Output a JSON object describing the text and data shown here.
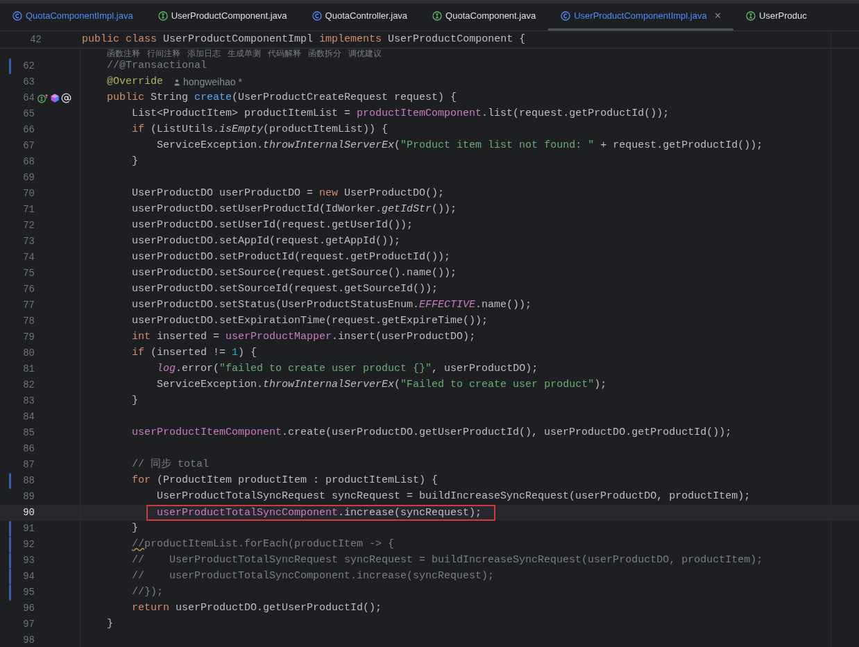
{
  "tabs": [
    {
      "label": "QuotaComponentImpl.java",
      "kind": "class",
      "color": "#548af7",
      "selected": false
    },
    {
      "label": "UserProductComponent.java",
      "kind": "interface",
      "color": "#dfe1e5",
      "selected": false
    },
    {
      "label": "QuotaController.java",
      "kind": "class",
      "color": "#dfe1e5",
      "selected": false
    },
    {
      "label": "QuotaComponent.java",
      "kind": "interface",
      "color": "#dfe1e5",
      "selected": false
    },
    {
      "label": "UserProductComponentImpl.java",
      "kind": "class",
      "color": "#548af7",
      "selected": true,
      "close": "×"
    },
    {
      "label": "UserProduc",
      "kind": "interface",
      "color": "#dfe1e5",
      "selected": false
    }
  ],
  "sticky_line": {
    "number": "42",
    "tokens": [
      {
        "kind": "kw",
        "text": "public class "
      },
      {
        "kind": "plain",
        "text": "UserProductComponentImpl "
      },
      {
        "kind": "kw",
        "text": "implements "
      },
      {
        "kind": "plain",
        "text": "UserProductComponent {"
      }
    ]
  },
  "code_lens": [
    "函数注释",
    "行间注释",
    "添加日志",
    "生成单测",
    "代码解释",
    "函数拆分",
    "调优建议"
  ],
  "lines": [
    {
      "number": "62",
      "modified": true,
      "tokens": [
        {
          "kind": "comment",
          "text": "    //@Transactional"
        }
      ]
    },
    {
      "number": "63",
      "tokens": [
        {
          "kind": "annotation",
          "text": "    @Override"
        }
      ],
      "author": "hongweihao *"
    },
    {
      "number": "64",
      "gutter_icons": true,
      "tokens": [
        {
          "kind": "kw",
          "text": "    public "
        },
        {
          "kind": "plain",
          "text": "String "
        },
        {
          "kind": "fn",
          "text": "create"
        },
        {
          "kind": "plain",
          "text": "(UserProductCreateRequest request) {"
        }
      ]
    },
    {
      "number": "65",
      "tokens": [
        {
          "kind": "plain",
          "text": "        List<ProductItem> productItemList = "
        },
        {
          "kind": "field",
          "text": "productItemComponent"
        },
        {
          "kind": "plain",
          "text": ".list(request.getProductId());"
        }
      ]
    },
    {
      "number": "66",
      "tokens": [
        {
          "kind": "kw",
          "text": "        if "
        },
        {
          "kind": "plain",
          "text": "(ListUtils."
        },
        {
          "kind": "static",
          "text": "isEmpty"
        },
        {
          "kind": "plain",
          "text": "(productItemList)) {"
        }
      ]
    },
    {
      "number": "67",
      "tokens": [
        {
          "kind": "plain",
          "text": "            ServiceException."
        },
        {
          "kind": "static",
          "text": "throwInternalServerEx"
        },
        {
          "kind": "plain",
          "text": "("
        },
        {
          "kind": "str",
          "text": "\"Product item list not found: \""
        },
        {
          "kind": "plain",
          "text": " + request.getProductId());"
        }
      ]
    },
    {
      "number": "68",
      "tokens": [
        {
          "kind": "plain",
          "text": "        }"
        }
      ]
    },
    {
      "number": "69"
    },
    {
      "number": "70",
      "tokens": [
        {
          "kind": "plain",
          "text": "        UserProductDO userProductDO = "
        },
        {
          "kind": "kw",
          "text": "new "
        },
        {
          "kind": "plain",
          "text": "UserProductDO();"
        }
      ]
    },
    {
      "number": "71",
      "tokens": [
        {
          "kind": "plain",
          "text": "        userProductDO.setUserProductId(IdWorker."
        },
        {
          "kind": "static",
          "text": "getIdStr"
        },
        {
          "kind": "plain",
          "text": "());"
        }
      ]
    },
    {
      "number": "72",
      "tokens": [
        {
          "kind": "plain",
          "text": "        userProductDO.setUserId(request.getUserId());"
        }
      ]
    },
    {
      "number": "73",
      "tokens": [
        {
          "kind": "plain",
          "text": "        userProductDO.setAppId(request.getAppId());"
        }
      ]
    },
    {
      "number": "74",
      "tokens": [
        {
          "kind": "plain",
          "text": "        userProductDO.setProductId(request.getProductId());"
        }
      ]
    },
    {
      "number": "75",
      "tokens": [
        {
          "kind": "plain",
          "text": "        userProductDO.setSource(request.getSource().name());"
        }
      ]
    },
    {
      "number": "76",
      "tokens": [
        {
          "kind": "plain",
          "text": "        userProductDO.setSourceId(request.getSourceId());"
        }
      ]
    },
    {
      "number": "77",
      "tokens": [
        {
          "kind": "plain",
          "text": "        userProductDO.setStatus(UserProductStatusEnum."
        },
        {
          "kind": "constant",
          "text": "EFFECTIVE"
        },
        {
          "kind": "plain",
          "text": ".name());"
        }
      ]
    },
    {
      "number": "78",
      "tokens": [
        {
          "kind": "plain",
          "text": "        userProductDO.setExpirationTime(request.getExpireTime());"
        }
      ]
    },
    {
      "number": "79",
      "tokens": [
        {
          "kind": "kw",
          "text": "        int "
        },
        {
          "kind": "plain",
          "text": "inserted = "
        },
        {
          "kind": "field",
          "text": "userProductMapper"
        },
        {
          "kind": "plain",
          "text": ".insert(userProductDO);"
        }
      ]
    },
    {
      "number": "80",
      "tokens": [
        {
          "kind": "kw",
          "text": "        if "
        },
        {
          "kind": "plain",
          "text": "(inserted != "
        },
        {
          "kind": "num",
          "text": "1"
        },
        {
          "kind": "plain",
          "text": ") {"
        }
      ]
    },
    {
      "number": "81",
      "tokens": [
        {
          "kind": "constant",
          "text": "            log"
        },
        {
          "kind": "plain",
          "text": ".error("
        },
        {
          "kind": "str",
          "text": "\"failed to create user product {}\""
        },
        {
          "kind": "plain",
          "text": ", userProductDO);"
        }
      ]
    },
    {
      "number": "82",
      "tokens": [
        {
          "kind": "plain",
          "text": "            ServiceException."
        },
        {
          "kind": "static",
          "text": "throwInternalServerEx"
        },
        {
          "kind": "plain",
          "text": "("
        },
        {
          "kind": "str",
          "text": "\"Failed to create user product\""
        },
        {
          "kind": "plain",
          "text": ");"
        }
      ]
    },
    {
      "number": "83",
      "tokens": [
        {
          "kind": "plain",
          "text": "        }"
        }
      ]
    },
    {
      "number": "84"
    },
    {
      "number": "85",
      "tokens": [
        {
          "kind": "field",
          "text": "        userProductItemComponent"
        },
        {
          "kind": "plain",
          "text": ".create(userProductDO.getUserProductId(), userProductDO.getProductId());"
        }
      ]
    },
    {
      "number": "86"
    },
    {
      "number": "87",
      "tokens": [
        {
          "kind": "comment",
          "text": "        // 同步 total"
        }
      ]
    },
    {
      "number": "88",
      "modified": true,
      "tokens": [
        {
          "kind": "kw",
          "text": "        for "
        },
        {
          "kind": "plain",
          "text": "(ProductItem productItem : productItemList) {"
        }
      ]
    },
    {
      "number": "89",
      "tokens": [
        {
          "kind": "plain",
          "text": "            UserProductTotalSyncRequest syncRequest = buildIncreaseSyncRequest(userProductDO, productItem);"
        }
      ]
    },
    {
      "number": "90",
      "current": true,
      "boxed": true,
      "tokens": [
        {
          "kind": "field",
          "text": "            userProductTotalSyncComponent"
        },
        {
          "kind": "plain",
          "text": ".increase(syncRequest);"
        }
      ]
    },
    {
      "number": "91",
      "modified": true,
      "tokens": [
        {
          "kind": "plain",
          "text": "        }"
        }
      ]
    },
    {
      "number": "92",
      "modified": true,
      "tokens": [
        {
          "kind": "comment_typo",
          "text": "        //"
        },
        {
          "kind": "comment",
          "text": "productItemList.forEach(productItem -> {"
        }
      ]
    },
    {
      "number": "93",
      "modified": true,
      "tokens": [
        {
          "kind": "comment",
          "text": "        //    UserProductTotalSyncRequest syncRequest = buildIncreaseSyncRequest(userProductDO, productItem);"
        }
      ]
    },
    {
      "number": "94",
      "modified": true,
      "tokens": [
        {
          "kind": "comment",
          "text": "        //    userProductTotalSyncComponent.increase(syncRequest);"
        }
      ]
    },
    {
      "number": "95",
      "modified": true,
      "tokens": [
        {
          "kind": "comment",
          "text": "        //});"
        }
      ]
    },
    {
      "number": "96",
      "tokens": [
        {
          "kind": "kw",
          "text": "        return "
        },
        {
          "kind": "plain",
          "text": "userProductDO.getUserProductId();"
        }
      ]
    },
    {
      "number": "97",
      "tokens": [
        {
          "kind": "plain",
          "text": "    }"
        }
      ]
    },
    {
      "number": "98"
    }
  ]
}
